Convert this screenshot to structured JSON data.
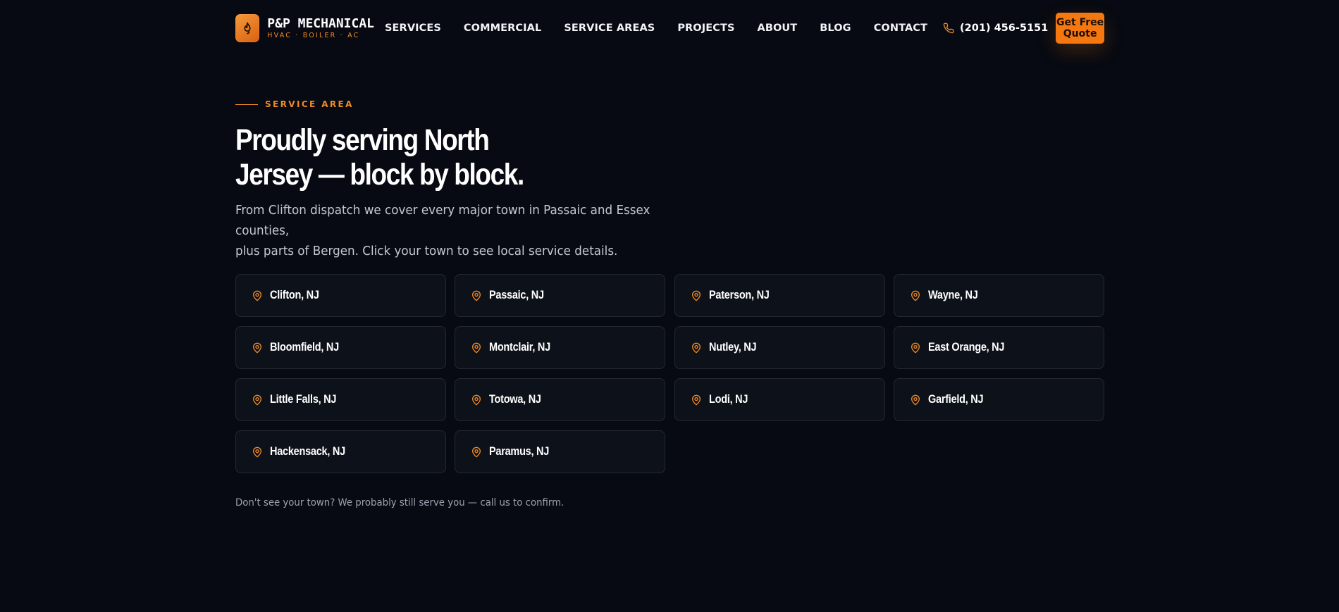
{
  "brand": {
    "name": "P&P MECHANICAL",
    "tagline": "HVAC · BOILER · AC",
    "accent_color": "#f5770f",
    "logo_icon": "flame-icon"
  },
  "nav": {
    "items": [
      {
        "label": "SERVICES"
      },
      {
        "label": "COMMERCIAL"
      },
      {
        "label": "SERVICE AREAS"
      },
      {
        "label": "PROJECTS"
      },
      {
        "label": "ABOUT"
      },
      {
        "label": "BLOG"
      },
      {
        "label": "CONTACT"
      }
    ],
    "phone": "(201) 456-5151",
    "phone_icon": "phone-icon",
    "cta_label": "Get Free Quote"
  },
  "hero": {
    "eyebrow": "SERVICE AREA",
    "headline_line1": "Proudly serving North",
    "headline_line2": "Jersey — block by block.",
    "lead_line1": "From Clifton dispatch we cover every major town in Passaic and Essex counties,",
    "lead_line2": "plus parts of Bergen. Click your town to see local service details."
  },
  "towns": [
    {
      "label": "Clifton, NJ"
    },
    {
      "label": "Passaic, NJ"
    },
    {
      "label": "Paterson, NJ"
    },
    {
      "label": "Wayne, NJ"
    },
    {
      "label": "Bloomfield, NJ"
    },
    {
      "label": "Montclair, NJ"
    },
    {
      "label": "Nutley, NJ"
    },
    {
      "label": "East Orange, NJ"
    },
    {
      "label": "Little Falls, NJ"
    },
    {
      "label": "Totowa, NJ"
    },
    {
      "label": "Lodi, NJ"
    },
    {
      "label": "Garfield, NJ"
    },
    {
      "label": "Hackensack, NJ"
    },
    {
      "label": "Paramus, NJ"
    }
  ],
  "town_icon": "map-pin-icon",
  "footnote": "Don't see your town? We probably still serve you — call us to confirm."
}
